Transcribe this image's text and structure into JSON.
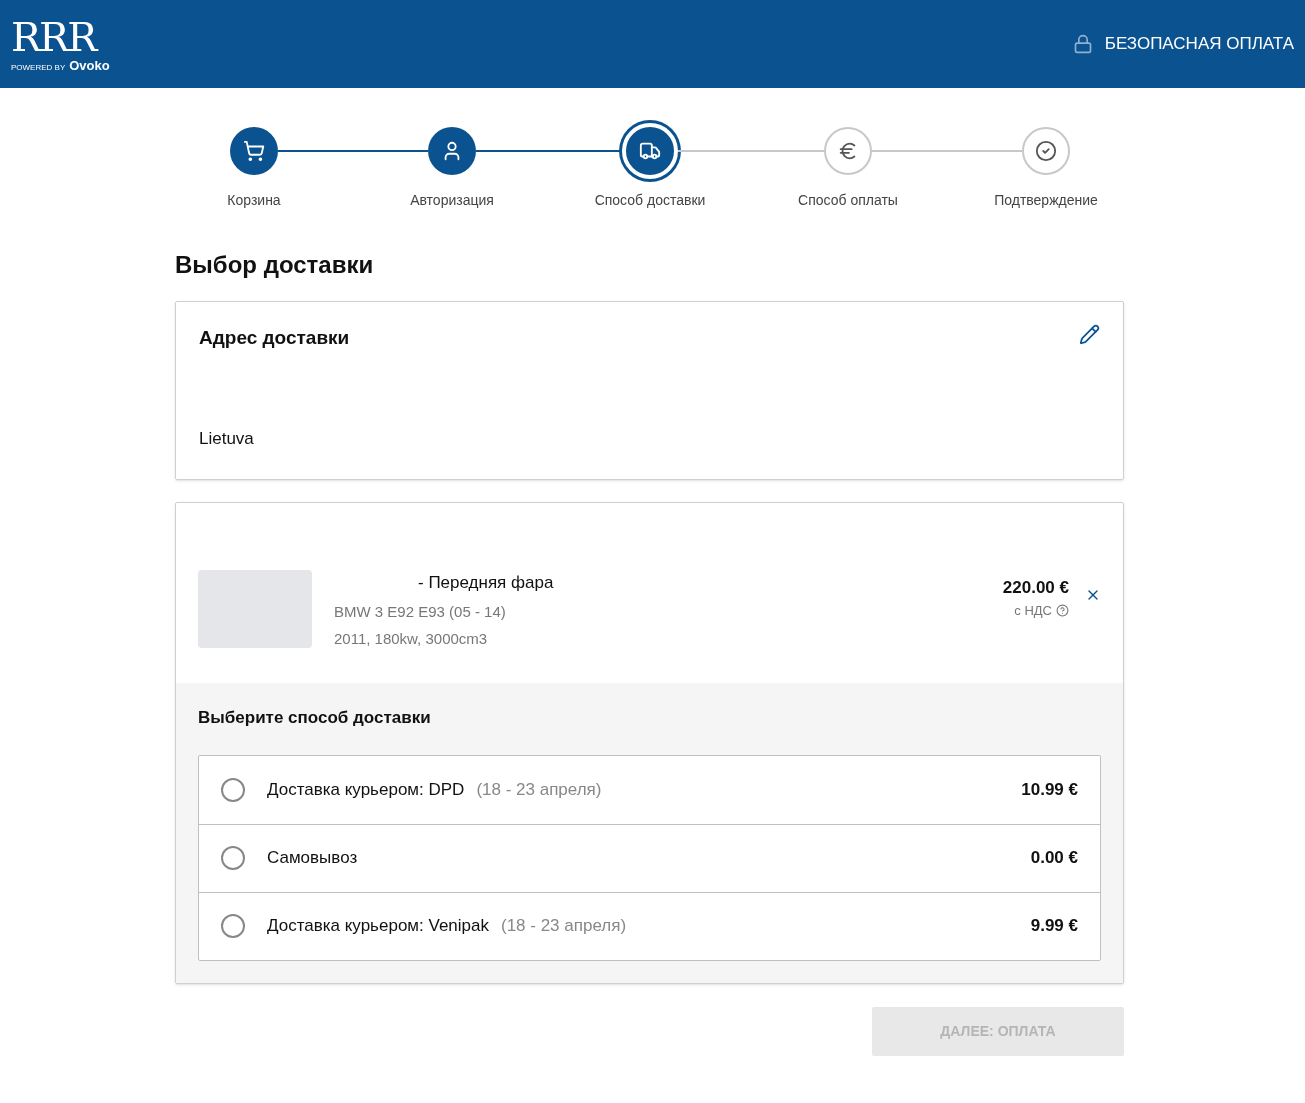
{
  "header": {
    "logo": {
      "mark": "RRR",
      "powered_by": "POWERED BY",
      "brand": "Ovoko"
    },
    "secure_label": "БЕЗОПАСНАЯ ОПЛАТА"
  },
  "steps": [
    {
      "label": "Корзина",
      "completed": true,
      "selected": false
    },
    {
      "label": "Авторизация",
      "completed": true,
      "selected": false
    },
    {
      "label": "Способ доставки",
      "completed": false,
      "selected": true
    },
    {
      "label": "Способ оплаты",
      "completed": false,
      "selected": false
    },
    {
      "label": "Подтверждение",
      "completed": false,
      "selected": false
    }
  ],
  "title": "Выбор доставки",
  "address": {
    "title": "Адрес доставки",
    "country": "Lietuva"
  },
  "item": {
    "name": "- Передняя фара",
    "car": "BMW 3 E92 E93 (05 - 14)",
    "details": "2011, 180kw, 3000cm3",
    "price": "220.00 €",
    "vat": "с НДС"
  },
  "delivery": {
    "title": "Выберите способ доставки",
    "options": [
      {
        "name": "Доставка курьером: DPD",
        "dates": "(18 - 23 апреля)",
        "price": "10.99 €",
        "selected": false
      },
      {
        "name": "Самовывоз",
        "price": "0.00 €",
        "selected": false
      },
      {
        "name": "Доставка курьером: Venipak",
        "dates": "(18 - 23 апреля)",
        "price": "9.99 €",
        "selected": false
      }
    ]
  },
  "next_button": {
    "label": "ДАЛЕЕ: ОПЛАТА",
    "disabled": true
  }
}
